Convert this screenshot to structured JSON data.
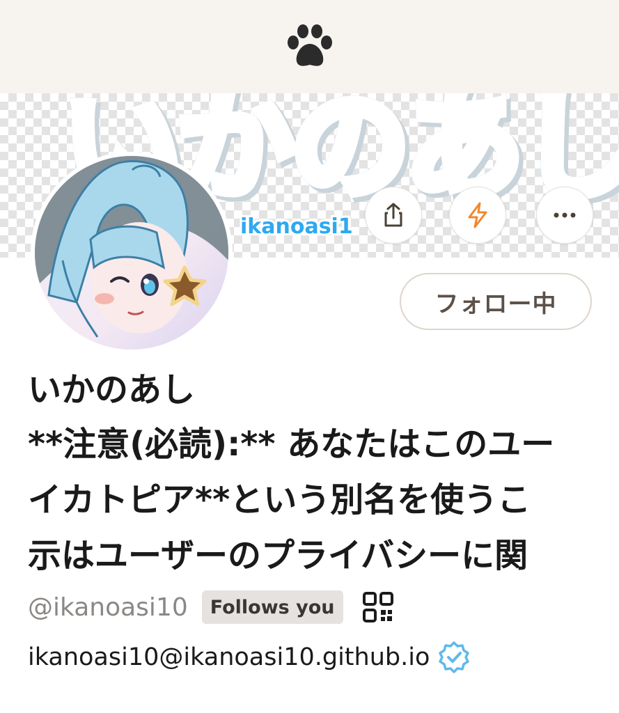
{
  "topbar": {
    "logo_icon": "paw-icon"
  },
  "banner": {
    "title": "いかのあし",
    "subtitle": "ikanoasi1",
    "colors": {
      "title_gray": "#8c9aa5",
      "title_blue": "#2ea9f0"
    }
  },
  "actions": {
    "share_icon": "share-icon",
    "react_icon": "lightning-icon",
    "more_icon": "more-horizontal-icon",
    "follow_label": "フォロー中"
  },
  "profile": {
    "display_name": "いかのあし",
    "bio_lines": [
      "**注意(必読):** あなたはこのユー",
      "イカトピア**という別名を使うこ",
      "示はユーザーのプライバシーに関"
    ],
    "handle": "@ikanoasi10",
    "follows_badge": "Follows you",
    "qr_icon": "qr-code-icon",
    "account": "ikanoasi10@ikanoasi10.github.io",
    "verified_icon": "verified-badge-icon"
  },
  "colors": {
    "accent_orange": "#f0882c",
    "verified_blue": "#5fb9ec",
    "topbar_bg": "#f7f4f0"
  }
}
